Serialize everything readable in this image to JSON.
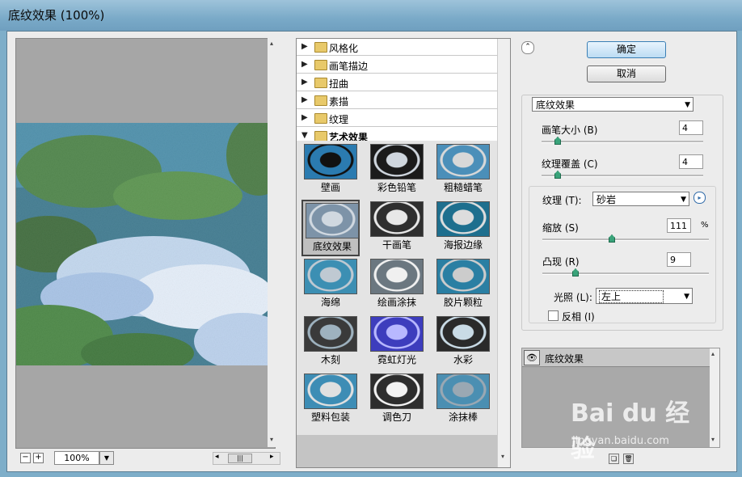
{
  "window": {
    "title": "底纹效果 (100%)"
  },
  "preview": {
    "zoom_minus": "−",
    "zoom_plus": "+",
    "zoom_value": "100%",
    "scroll_thumb": "|||",
    "scroll_left": "◂",
    "scroll_right": "▸",
    "scroll_up": "▴",
    "scroll_down": "▾"
  },
  "filter_list": {
    "categories": [
      {
        "label": "风格化"
      },
      {
        "label": "画笔描边"
      },
      {
        "label": "扭曲"
      },
      {
        "label": "素描"
      },
      {
        "label": "纹理"
      }
    ],
    "open_category": "艺术效果",
    "collapsed_glyph": "▶",
    "expanded_glyph": "▼",
    "filters": [
      {
        "label": "壁画"
      },
      {
        "label": "彩色铅笔"
      },
      {
        "label": "粗糙蜡笔"
      },
      {
        "label": "底纹效果"
      },
      {
        "label": "干画笔"
      },
      {
        "label": "海报边缘"
      },
      {
        "label": "海绵"
      },
      {
        "label": "绘画涂抹"
      },
      {
        "label": "胶片颗粒"
      },
      {
        "label": "木刻"
      },
      {
        "label": "霓虹灯光"
      },
      {
        "label": "水彩"
      },
      {
        "label": "塑料包装"
      },
      {
        "label": "调色刀"
      },
      {
        "label": "涂抹棒"
      }
    ],
    "selected_filter_index": 3
  },
  "buttons": {
    "ok": "确定",
    "cancel": "取消",
    "collapse": "⌃"
  },
  "settings": {
    "filter_select": "底纹效果",
    "brush_size": {
      "label": "画笔大小 (B)",
      "value": "4",
      "slider_fraction": 0.08
    },
    "texture_coverage": {
      "label": "纹理覆盖 (C)",
      "value": "4",
      "slider_fraction": 0.08
    },
    "texture": {
      "label": "纹理 (T):",
      "value": "砂岩",
      "menu_glyph": "▸"
    },
    "scaling": {
      "label": "缩放 (S)",
      "value": "111",
      "unit": "%",
      "slider_fraction": 0.4
    },
    "relief": {
      "label": "凸现 (R)",
      "value": "9",
      "slider_fraction": 0.18
    },
    "light": {
      "label": "光照 (L):",
      "value": "左上"
    },
    "invert": {
      "label": "反相 (I)",
      "checked": false
    }
  },
  "layers": {
    "layer_name": "底纹效果",
    "eye_glyph": "👁",
    "new_glyph": "❏",
    "delete_glyph": "🗑"
  },
  "watermark": {
    "logo": "Bai du 经验",
    "url": "jingyan.baidu.com"
  },
  "colors": {
    "title_bar": "#7eaec9",
    "ok_accent": "#3a7fb5",
    "slider_knob": "#3aa37a"
  }
}
